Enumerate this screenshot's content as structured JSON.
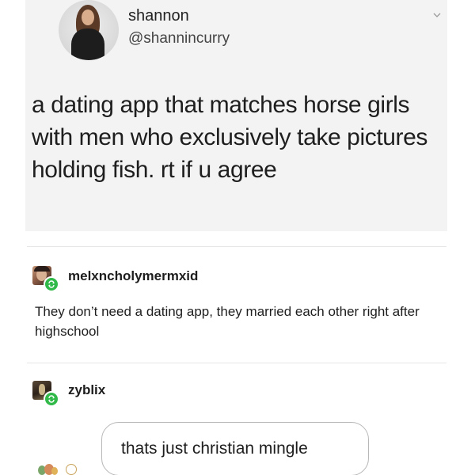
{
  "tweet": {
    "author_name": "shannon",
    "author_handle": "@shannincurry",
    "text": "a dating app that matches horse girls with men who exclusively take pictures holding fish. rt if u agree",
    "icons": {
      "avatar": "profile-photo",
      "caret": "chevron-down-icon"
    }
  },
  "replies": [
    {
      "username": "melxncholymermxid",
      "text": "They don’t need a dating app, they married each other right after highschool",
      "badge_icon": "reblog-icon",
      "badge_color": "#31b94a"
    },
    {
      "username": "zyblix",
      "badge_icon": "reblog-icon",
      "badge_color": "#31b94a"
    }
  ],
  "chat_bubble": {
    "text": "thats just christian mingle"
  },
  "colors": {
    "tweet_background": "#f3f3f3",
    "reblog_green": "#31b94a",
    "bubble_border": "#b8b8b8"
  }
}
